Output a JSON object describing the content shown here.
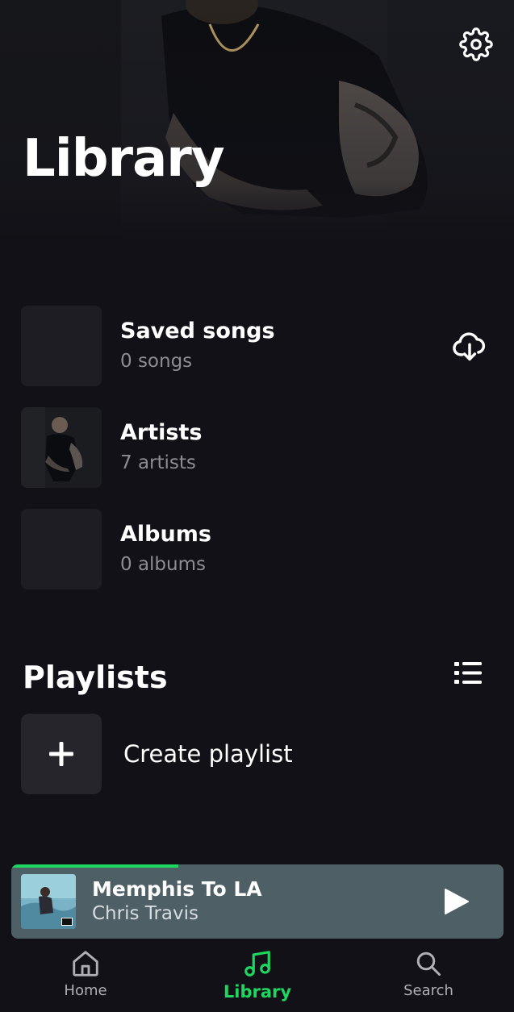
{
  "header": {
    "title": "Library",
    "settings_icon": "gear-icon"
  },
  "library": {
    "items": [
      {
        "title": "Saved songs",
        "subtitle": "0 songs",
        "icon": "cloud-download-icon"
      },
      {
        "title": "Artists",
        "subtitle": "7 artists"
      },
      {
        "title": "Albums",
        "subtitle": "0 albums"
      }
    ]
  },
  "playlists": {
    "title": "Playlists",
    "view_icon": "list-view-icon",
    "create_label": "Create playlist"
  },
  "now_playing": {
    "title": "Memphis To LA",
    "artist": "Chris Travis",
    "progress": 0.34,
    "play_icon": "play-icon"
  },
  "nav": {
    "items": [
      {
        "label": "Home",
        "icon": "home-icon",
        "active": false
      },
      {
        "label": "Library",
        "icon": "music-note-icon",
        "active": true
      },
      {
        "label": "Search",
        "icon": "search-icon",
        "active": false
      }
    ]
  },
  "colors": {
    "background": "#121117",
    "accent": "#1ed760",
    "player_bg": "#4e6065",
    "muted_text": "#8d8c93"
  }
}
